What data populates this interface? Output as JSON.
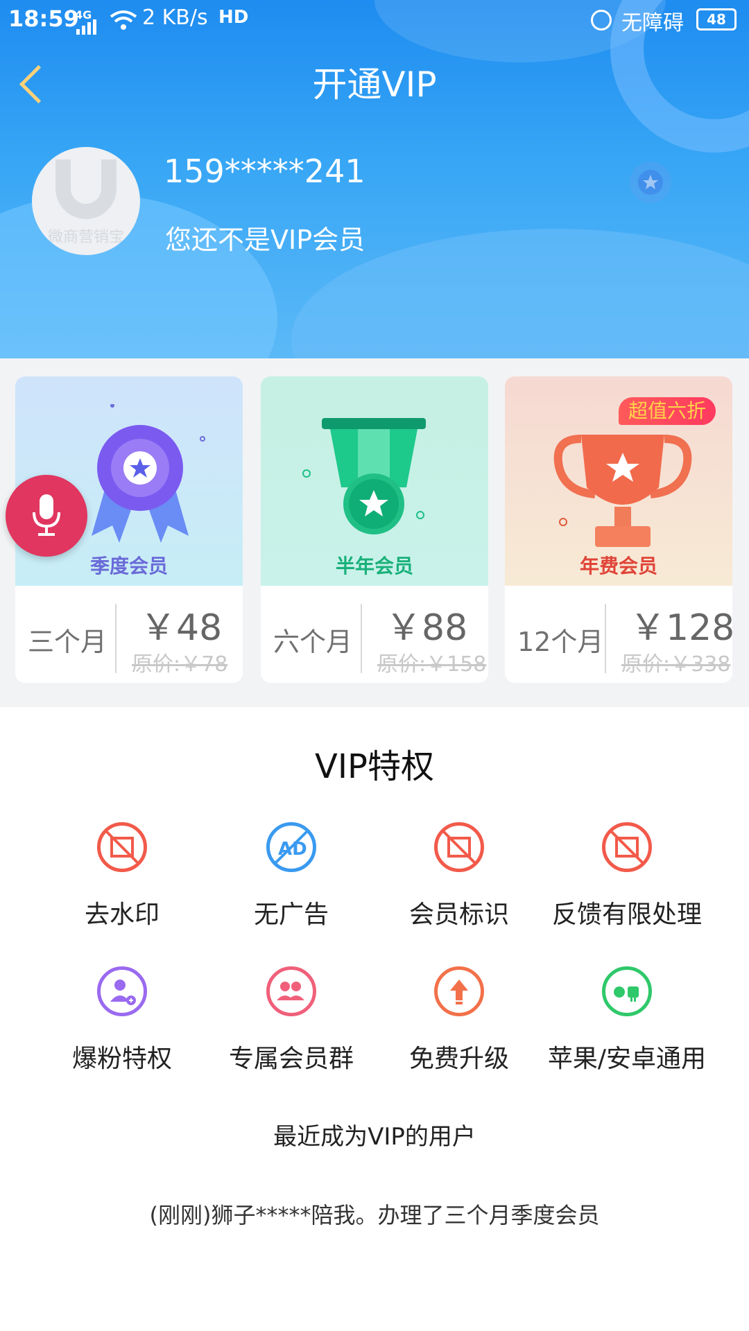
{
  "status_bar": {
    "time": "18:59",
    "network": "4G",
    "speed": "2 KB/s",
    "hd": "HD",
    "accessibility": "无障碍",
    "battery": "48"
  },
  "header": {
    "title": "开通VIP",
    "back_icon": "chevron-left-icon",
    "avatar_text": "微商营销宝",
    "phone": "159*****241",
    "membership_status": "您还不是VIP会员"
  },
  "plans": [
    {
      "name": "季度会员",
      "duration": "三个月",
      "price": "￥48",
      "original": "原价:￥78",
      "icon": "rosette-badge-icon",
      "name_color": "#6a6ad8",
      "tag": ""
    },
    {
      "name": "半年会员",
      "duration": "六个月",
      "price": "￥88",
      "original": "原价:￥158",
      "icon": "medal-icon",
      "name_color": "#19b07a",
      "tag": ""
    },
    {
      "name": "年费会员",
      "duration": "12个月",
      "price": "￥128",
      "original": "原价:￥338",
      "icon": "trophy-icon",
      "name_color": "#e05a3a",
      "tag": "超值六折"
    }
  ],
  "floating": {
    "icon": "microphone-icon"
  },
  "privileges": {
    "title": "VIP特权",
    "items": [
      {
        "label": "去水印",
        "icon": "no-watermark-icon"
      },
      {
        "label": "无广告",
        "icon": "no-ads-icon"
      },
      {
        "label": "会员标识",
        "icon": "member-badge-icon"
      },
      {
        "label": "反馈有限处理",
        "icon": "feedback-icon"
      },
      {
        "label": "爆粉特权",
        "icon": "add-fans-icon"
      },
      {
        "label": "专属会员群",
        "icon": "member-group-icon"
      },
      {
        "label": "免费升级",
        "icon": "upgrade-icon"
      },
      {
        "label": "苹果/安卓通用",
        "icon": "apple-android-icon"
      }
    ]
  },
  "recent": {
    "title": "最近成为VIP的用户",
    "entry": "(刚刚)狮子*****陪我。办理了三个月季度会员"
  },
  "colors": {
    "header_blue": "#2a98f2",
    "mic_red": "#e0365f",
    "tag_red": "#ff4060",
    "tag_text": "#ffd34a"
  }
}
